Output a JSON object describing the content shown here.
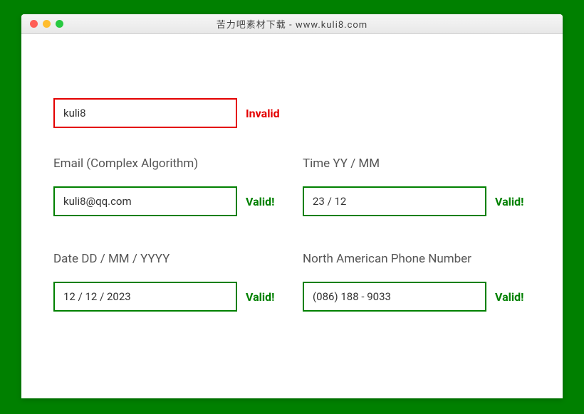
{
  "window": {
    "title": "苦力吧素材下载 - www.kuli8.com"
  },
  "status_labels": {
    "valid": "Valid!",
    "invalid": "Invalid"
  },
  "fields": {
    "top": {
      "value": "kuli8",
      "status": "invalid"
    },
    "email": {
      "label": "Email (Complex Algorithm)",
      "value": "kuli8@qq.com",
      "status": "valid"
    },
    "time": {
      "label": "Time YY / MM",
      "value": "23 / 12",
      "status": "valid"
    },
    "date": {
      "label": "Date DD / MM / YYYY",
      "value": "12 / 12 / 2023",
      "status": "valid"
    },
    "phone": {
      "label": "North American Phone Number",
      "value": "(086) 188 - 9033",
      "status": "valid"
    }
  }
}
